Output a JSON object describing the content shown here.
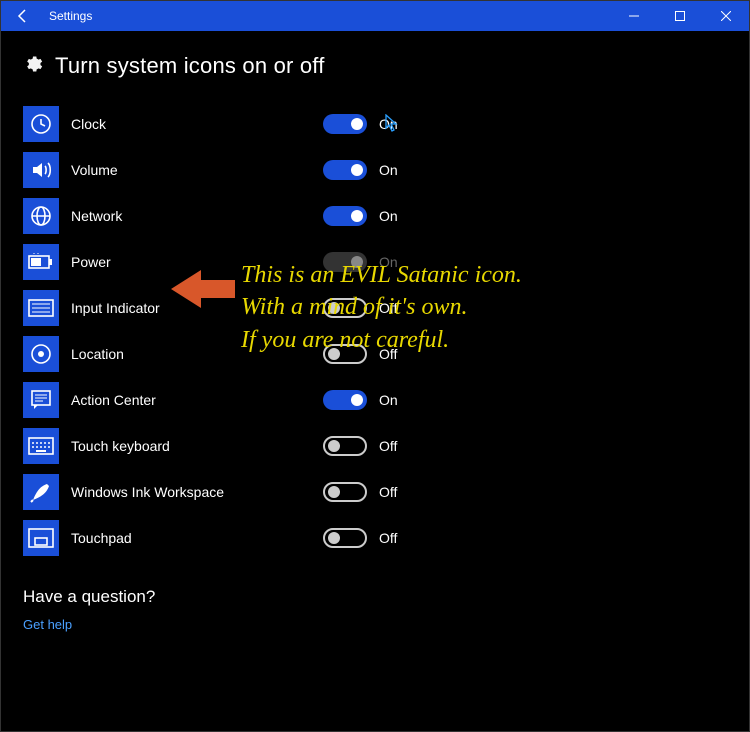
{
  "window": {
    "title": "Settings"
  },
  "page": {
    "heading": "Turn system icons on or off"
  },
  "items": [
    {
      "icon": "clock",
      "label": "Clock",
      "state": "On",
      "on": true,
      "disabled": false
    },
    {
      "icon": "volume",
      "label": "Volume",
      "state": "On",
      "on": true,
      "disabled": false
    },
    {
      "icon": "network",
      "label": "Network",
      "state": "On",
      "on": true,
      "disabled": false
    },
    {
      "icon": "power",
      "label": "Power",
      "state": "On",
      "on": true,
      "disabled": true
    },
    {
      "icon": "input-indicator",
      "label": "Input Indicator",
      "state": "Off",
      "on": false,
      "disabled": false
    },
    {
      "icon": "location",
      "label": "Location",
      "state": "Off",
      "on": false,
      "disabled": false
    },
    {
      "icon": "action-center",
      "label": "Action Center",
      "state": "On",
      "on": true,
      "disabled": false
    },
    {
      "icon": "touch-keyboard",
      "label": "Touch keyboard",
      "state": "Off",
      "on": false,
      "disabled": false
    },
    {
      "icon": "ink",
      "label": "Windows Ink Workspace",
      "state": "Off",
      "on": false,
      "disabled": false
    },
    {
      "icon": "touchpad",
      "label": "Touchpad",
      "state": "Off",
      "on": false,
      "disabled": false
    }
  ],
  "help": {
    "heading": "Have a question?",
    "link": "Get help"
  },
  "annotation": {
    "line1": "This is an EVIL Satanic icon.",
    "line2": "With a mind of it's own.",
    "line3": "If you are not careful."
  }
}
